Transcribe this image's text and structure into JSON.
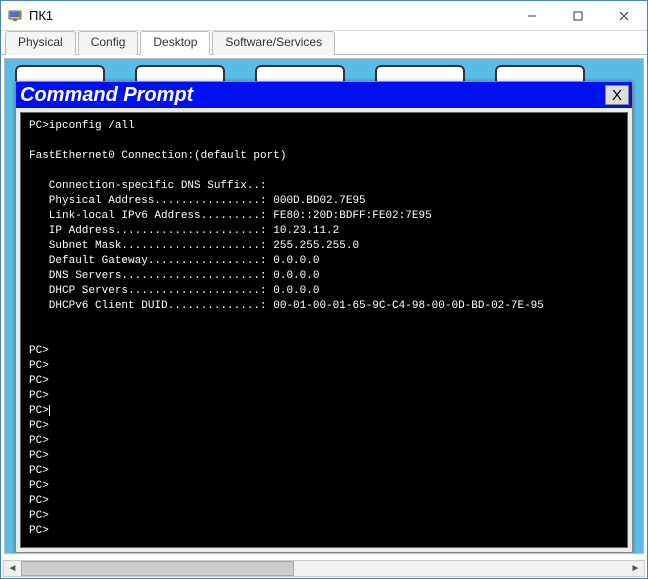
{
  "window": {
    "title": "ПК1"
  },
  "tabs": {
    "physical": "Physical",
    "config": "Config",
    "desktop": "Desktop",
    "software": "Software/Services"
  },
  "cmd": {
    "title": "Command Prompt",
    "close": "X"
  },
  "terminal": {
    "line_cmd": "PC>ipconfig /all",
    "line_conn": "FastEthernet0 Connection:(default port)",
    "line_dns": "   Connection-specific DNS Suffix..: ",
    "line_mac": "   Physical Address................: 000D.BD02.7E95",
    "line_ll6": "   Link-local IPv6 Address.........: FE80::20D:BDFF:FE02:7E95",
    "line_ip": "   IP Address......................: 10.23.11.2",
    "line_mask": "   Subnet Mask.....................: 255.255.255.0",
    "line_gw": "   Default Gateway.................: 0.0.0.0",
    "line_dnsv": "   DNS Servers.....................: 0.0.0.0",
    "line_dhcp": "   DHCP Servers....................: 0.0.0.0",
    "line_duid": "   DHCPv6 Client DUID..............: 00-01-00-01-65-9C-C4-98-00-0D-BD-02-7E-95",
    "prompt": "PC>"
  }
}
